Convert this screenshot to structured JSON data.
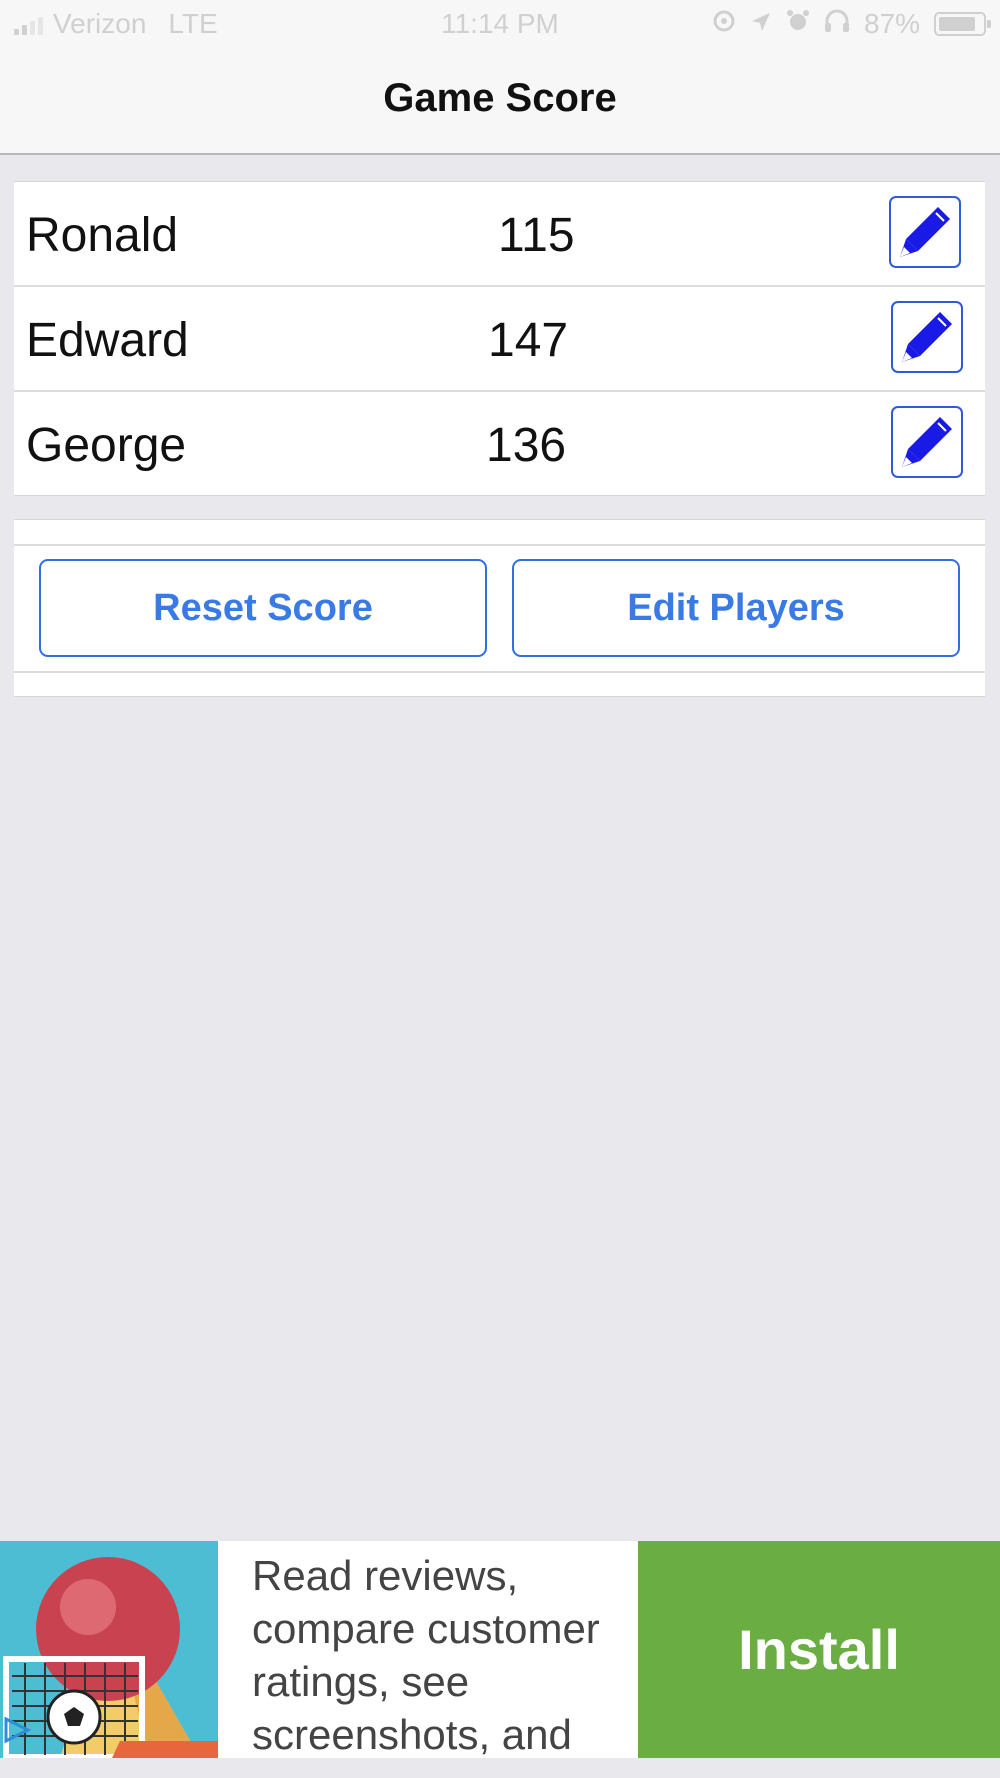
{
  "status_bar": {
    "carrier": "Verizon",
    "network": "LTE",
    "time": "11:14 PM",
    "battery": "87%"
  },
  "nav": {
    "title": "Game Score"
  },
  "players": [
    {
      "name": "Ronald",
      "score": "115"
    },
    {
      "name": "Edward",
      "score": "147"
    },
    {
      "name": "George",
      "score": "136"
    }
  ],
  "actions": {
    "reset_label": "Reset Score",
    "edit_players_label": "Edit Players"
  },
  "ad": {
    "text": "Read reviews, compare customer ratings, see screenshots, and",
    "install_label": "Install"
  },
  "colors": {
    "accent_blue": "#3a7ae4",
    "edit_icon_blue": "#1a1ae6",
    "install_green": "#69ad43",
    "background": "#e9e8ed"
  },
  "icons": [
    "signal-icon",
    "at-lock-icon",
    "location-arrow-icon",
    "alarm-icon",
    "headphones-icon",
    "battery-icon",
    "pencil-icon",
    "ad-choices-icon"
  ]
}
